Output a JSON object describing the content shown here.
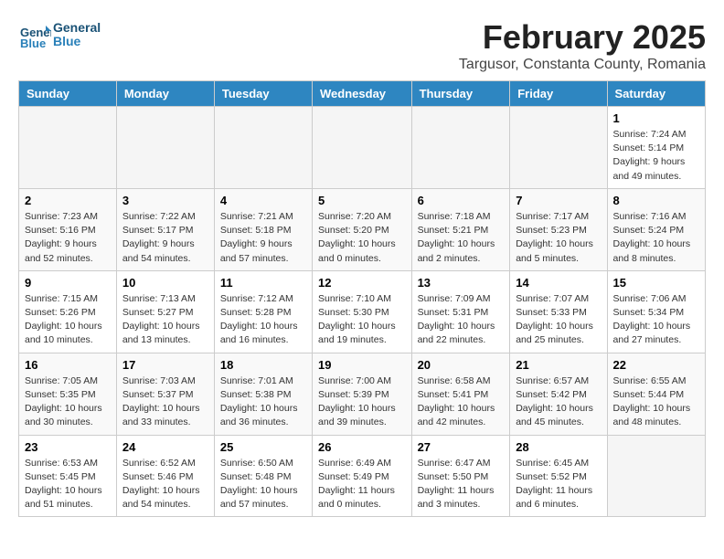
{
  "header": {
    "logo_general": "General",
    "logo_blue": "Blue",
    "month_year": "February 2025",
    "location": "Targusor, Constanta County, Romania"
  },
  "weekdays": [
    "Sunday",
    "Monday",
    "Tuesday",
    "Wednesday",
    "Thursday",
    "Friday",
    "Saturday"
  ],
  "weeks": [
    [
      {
        "day": "",
        "info": ""
      },
      {
        "day": "",
        "info": ""
      },
      {
        "day": "",
        "info": ""
      },
      {
        "day": "",
        "info": ""
      },
      {
        "day": "",
        "info": ""
      },
      {
        "day": "",
        "info": ""
      },
      {
        "day": "1",
        "info": "Sunrise: 7:24 AM\nSunset: 5:14 PM\nDaylight: 9 hours and 49 minutes."
      }
    ],
    [
      {
        "day": "2",
        "info": "Sunrise: 7:23 AM\nSunset: 5:16 PM\nDaylight: 9 hours and 52 minutes."
      },
      {
        "day": "3",
        "info": "Sunrise: 7:22 AM\nSunset: 5:17 PM\nDaylight: 9 hours and 54 minutes."
      },
      {
        "day": "4",
        "info": "Sunrise: 7:21 AM\nSunset: 5:18 PM\nDaylight: 9 hours and 57 minutes."
      },
      {
        "day": "5",
        "info": "Sunrise: 7:20 AM\nSunset: 5:20 PM\nDaylight: 10 hours and 0 minutes."
      },
      {
        "day": "6",
        "info": "Sunrise: 7:18 AM\nSunset: 5:21 PM\nDaylight: 10 hours and 2 minutes."
      },
      {
        "day": "7",
        "info": "Sunrise: 7:17 AM\nSunset: 5:23 PM\nDaylight: 10 hours and 5 minutes."
      },
      {
        "day": "8",
        "info": "Sunrise: 7:16 AM\nSunset: 5:24 PM\nDaylight: 10 hours and 8 minutes."
      }
    ],
    [
      {
        "day": "9",
        "info": "Sunrise: 7:15 AM\nSunset: 5:26 PM\nDaylight: 10 hours and 10 minutes."
      },
      {
        "day": "10",
        "info": "Sunrise: 7:13 AM\nSunset: 5:27 PM\nDaylight: 10 hours and 13 minutes."
      },
      {
        "day": "11",
        "info": "Sunrise: 7:12 AM\nSunset: 5:28 PM\nDaylight: 10 hours and 16 minutes."
      },
      {
        "day": "12",
        "info": "Sunrise: 7:10 AM\nSunset: 5:30 PM\nDaylight: 10 hours and 19 minutes."
      },
      {
        "day": "13",
        "info": "Sunrise: 7:09 AM\nSunset: 5:31 PM\nDaylight: 10 hours and 22 minutes."
      },
      {
        "day": "14",
        "info": "Sunrise: 7:07 AM\nSunset: 5:33 PM\nDaylight: 10 hours and 25 minutes."
      },
      {
        "day": "15",
        "info": "Sunrise: 7:06 AM\nSunset: 5:34 PM\nDaylight: 10 hours and 27 minutes."
      }
    ],
    [
      {
        "day": "16",
        "info": "Sunrise: 7:05 AM\nSunset: 5:35 PM\nDaylight: 10 hours and 30 minutes."
      },
      {
        "day": "17",
        "info": "Sunrise: 7:03 AM\nSunset: 5:37 PM\nDaylight: 10 hours and 33 minutes."
      },
      {
        "day": "18",
        "info": "Sunrise: 7:01 AM\nSunset: 5:38 PM\nDaylight: 10 hours and 36 minutes."
      },
      {
        "day": "19",
        "info": "Sunrise: 7:00 AM\nSunset: 5:39 PM\nDaylight: 10 hours and 39 minutes."
      },
      {
        "day": "20",
        "info": "Sunrise: 6:58 AM\nSunset: 5:41 PM\nDaylight: 10 hours and 42 minutes."
      },
      {
        "day": "21",
        "info": "Sunrise: 6:57 AM\nSunset: 5:42 PM\nDaylight: 10 hours and 45 minutes."
      },
      {
        "day": "22",
        "info": "Sunrise: 6:55 AM\nSunset: 5:44 PM\nDaylight: 10 hours and 48 minutes."
      }
    ],
    [
      {
        "day": "23",
        "info": "Sunrise: 6:53 AM\nSunset: 5:45 PM\nDaylight: 10 hours and 51 minutes."
      },
      {
        "day": "24",
        "info": "Sunrise: 6:52 AM\nSunset: 5:46 PM\nDaylight: 10 hours and 54 minutes."
      },
      {
        "day": "25",
        "info": "Sunrise: 6:50 AM\nSunset: 5:48 PM\nDaylight: 10 hours and 57 minutes."
      },
      {
        "day": "26",
        "info": "Sunrise: 6:49 AM\nSunset: 5:49 PM\nDaylight: 11 hours and 0 minutes."
      },
      {
        "day": "27",
        "info": "Sunrise: 6:47 AM\nSunset: 5:50 PM\nDaylight: 11 hours and 3 minutes."
      },
      {
        "day": "28",
        "info": "Sunrise: 6:45 AM\nSunset: 5:52 PM\nDaylight: 11 hours and 6 minutes."
      },
      {
        "day": "",
        "info": ""
      }
    ]
  ]
}
